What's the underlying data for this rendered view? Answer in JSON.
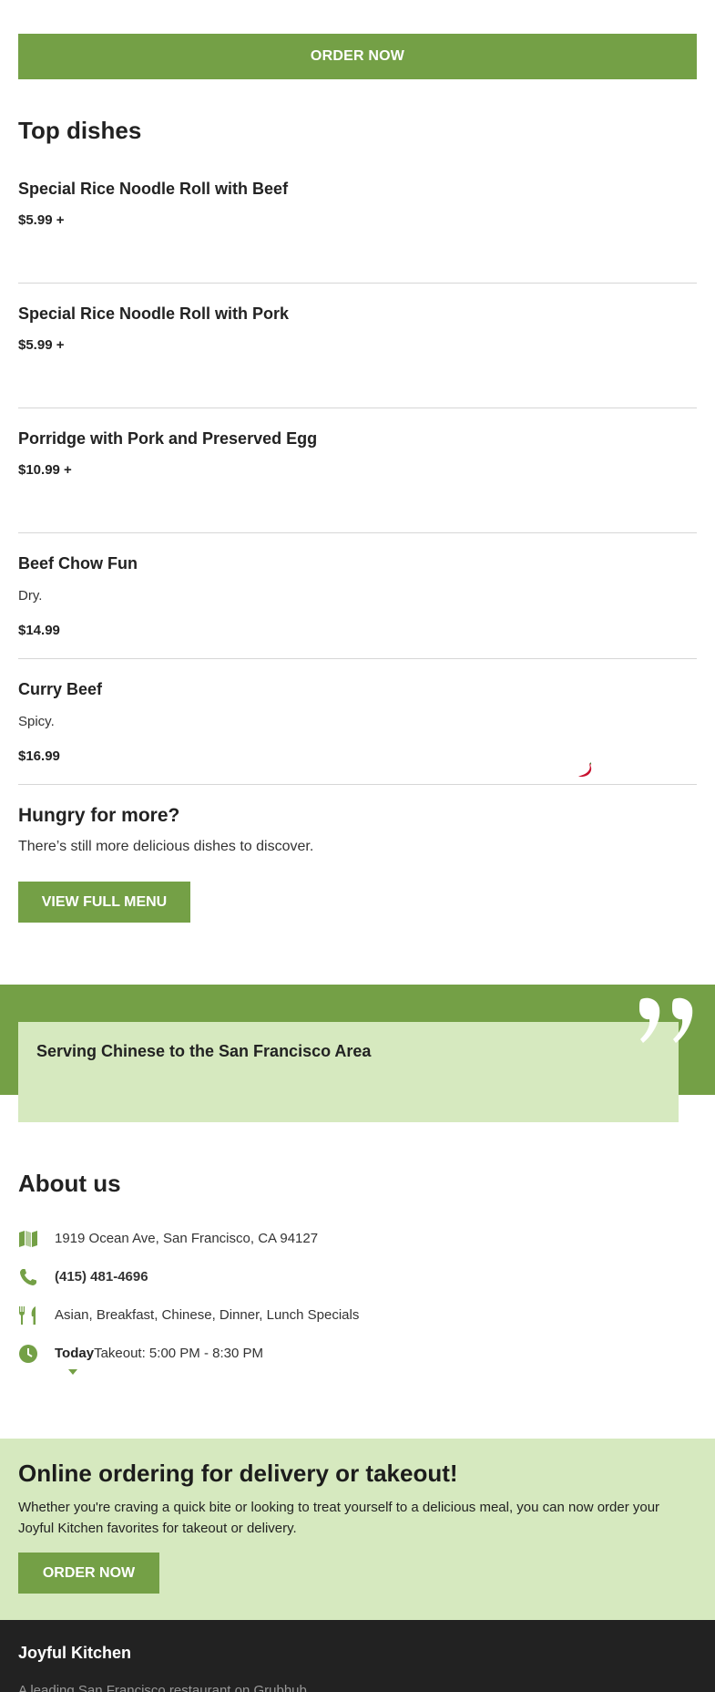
{
  "header": {
    "order_button_label": "ORDER NOW"
  },
  "top_dishes": {
    "title": "Top dishes",
    "items": [
      {
        "name": "Special Rice Noodle Roll with Beef",
        "description": "",
        "price": "$5.99 +"
      },
      {
        "name": "Special Rice Noodle Roll with Pork",
        "description": "",
        "price": "$5.99 +"
      },
      {
        "name": "Porridge with Pork and Preserved Egg",
        "description": "",
        "price": "$10.99 +"
      },
      {
        "name": "Beef Chow Fun",
        "description": "Dry.",
        "price": "$14.99"
      },
      {
        "name": "Curry Beef",
        "description": "Spicy.",
        "price": "$16.99",
        "icon": "chili-pepper-icon"
      }
    ]
  },
  "hungry": {
    "title": "Hungry for more?",
    "text": "There’s still more delicious dishes to discover.",
    "button_label": "VIEW FULL MENU"
  },
  "quote": {
    "text": "Serving Chinese to the San Francisco Area",
    "icon": "quote-icon"
  },
  "about": {
    "title": "About us",
    "address": "1919 Ocean Ave, San Francisco, CA 94127",
    "phone": "(415) 481-4696",
    "cuisines": "Asian, Breakfast, Chinese, Dinner, Lunch Specials",
    "hours_day": "Today",
    "hours_text": "Takeout: 5:00 PM - 8:30 PM",
    "icons": [
      "map-icon",
      "phone-icon",
      "utensils-icon",
      "clock-icon",
      "caret-down-icon"
    ]
  },
  "promo": {
    "title": "Online ordering for delivery or takeout!",
    "text": "Whether you're craving a quick bite or looking to treat yourself to a delicious meal, you can now order your Joyful Kitchen favorites for takeout or delivery.",
    "button_label": "ORDER NOW"
  },
  "footer": {
    "name": "Joyful Kitchen",
    "tagline": "A leading San Francisco restaurant on Grubhub"
  },
  "colors": {
    "brand_green": "#74a046",
    "light_green": "#d6e9bf",
    "footer_dark": "#222222",
    "pepper_red": "#c8102e"
  }
}
